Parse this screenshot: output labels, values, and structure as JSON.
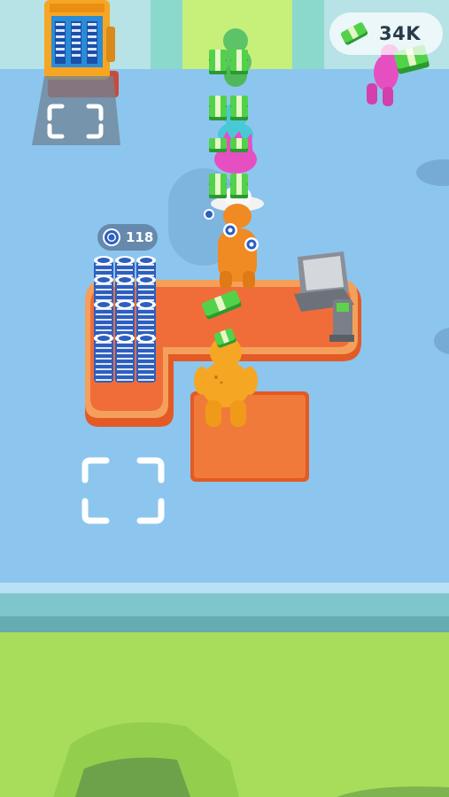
{
  "hud": {
    "cash_amount": "34K",
    "cash_icon": "cash-bundle-icon",
    "chip_count": "118",
    "chip_icon": "poker-chip-icon"
  },
  "colors": {
    "floor": "#8cc6ee",
    "grass": "#a8dd5c",
    "counter": "#f06d3a",
    "player": "#f5a623",
    "cash_green": "#3cc13c",
    "chip_blue": "#2d5fbf"
  }
}
